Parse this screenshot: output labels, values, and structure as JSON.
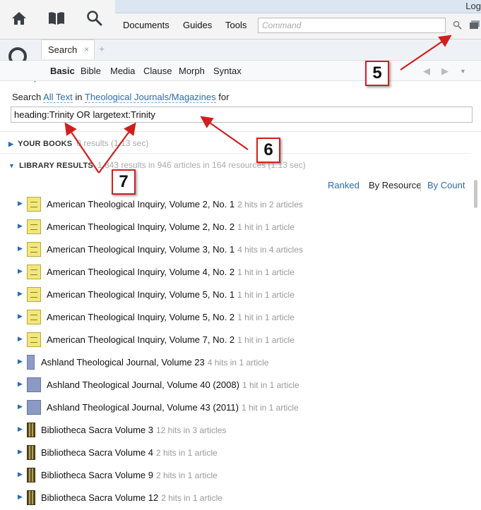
{
  "topbar": {
    "log_label": "Log",
    "menu": [
      "Documents",
      "Guides",
      "Tools"
    ],
    "command_placeholder": "Command"
  },
  "panel": {
    "tab_label": "Search",
    "tab_close": "×",
    "new_tab": "+",
    "subtabs": [
      "Basic",
      "Bible",
      "Media",
      "Clause",
      "Morph",
      "Syntax"
    ],
    "active_subtab": "Basic"
  },
  "query": {
    "prefix": "Search",
    "scope": "All Text",
    "in_word": "in",
    "collection": "Theological Journals/Magazines",
    "for_word": "for",
    "value": "heading:Trinity OR largetext:Trinity"
  },
  "sections": {
    "your_books": {
      "label": "YOUR BOOKS",
      "meta": "0 results (1.13 sec)"
    },
    "library": {
      "label": "LIBRARY RESULTS",
      "meta": "1,843 results in 946 articles in 164 resources (1.13 sec)"
    }
  },
  "sort_options": [
    "Ranked",
    "By Resource",
    "By Count"
  ],
  "active_sort": "By Resource",
  "results": [
    {
      "title": "American Theological Inquiry, Volume 2, No. 1",
      "hits": "2 hits in 2 articles",
      "cover": "y"
    },
    {
      "title": "American Theological Inquiry, Volume 2, No. 2",
      "hits": "1 hit in 1 article",
      "cover": "y"
    },
    {
      "title": "American Theological Inquiry, Volume 3, No. 1",
      "hits": "4 hits in 4 articles",
      "cover": "y"
    },
    {
      "title": "American Theological Inquiry, Volume 4, No. 2",
      "hits": "1 hit in 1 article",
      "cover": "y"
    },
    {
      "title": "American Theological Inquiry, Volume 5, No. 1",
      "hits": "1 hit in 1 article",
      "cover": "y"
    },
    {
      "title": "American Theological Inquiry, Volume 5, No. 2",
      "hits": "1 hit in 1 article",
      "cover": "y"
    },
    {
      "title": "American Theological Inquiry, Volume 7, No. 2",
      "hits": "1 hit in 1 article",
      "cover": "y"
    },
    {
      "title": "Ashland Theological Journal, Volume 23",
      "hits": "4 hits in 1 article",
      "cover": "b1"
    },
    {
      "title": "Ashland Theological Journal, Volume 40 (2008)",
      "hits": "1 hit in 1 article",
      "cover": "b2"
    },
    {
      "title": "Ashland Theological Journal, Volume 43 (2011)",
      "hits": "1 hit in 1 article",
      "cover": "b2"
    },
    {
      "title": "Bibliotheca Sacra Volume 3",
      "hits": "12 hits in 3 articles",
      "cover": "bs"
    },
    {
      "title": "Bibliotheca Sacra Volume 4",
      "hits": "2 hits in 1 article",
      "cover": "bs"
    },
    {
      "title": "Bibliotheca Sacra Volume 9",
      "hits": "2 hits in 1 article",
      "cover": "bs"
    },
    {
      "title": "Bibliotheca Sacra Volume 12",
      "hits": "2 hits in 1 article",
      "cover": "bs"
    }
  ],
  "annotations": [
    "5",
    "6",
    "7"
  ],
  "colors": {
    "link": "#2a6bb0",
    "annotation": "#d21e1e"
  }
}
